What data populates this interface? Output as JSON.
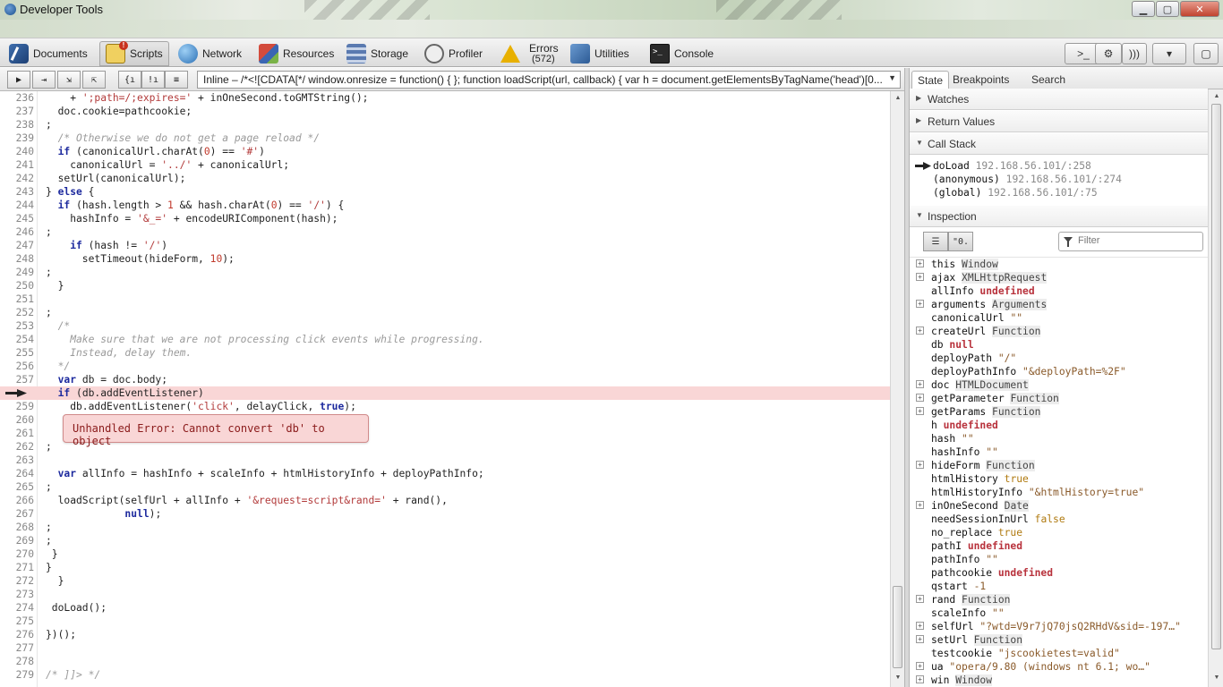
{
  "window": {
    "title": "Developer Tools",
    "controls": [
      "minimize",
      "maximize",
      "close"
    ]
  },
  "colors": {
    "error_highlight": "#f9d6d6",
    "keyword": "#1d2a9e",
    "string": "#b23a3a",
    "comment": "#9a9a9a",
    "undefined": "#b8323c"
  },
  "tabs": [
    {
      "label": "Documents",
      "icon": "documents-icon",
      "active": false
    },
    {
      "label": "Scripts",
      "icon": "scripts-icon",
      "active": true
    },
    {
      "label": "Network",
      "icon": "network-icon",
      "active": false
    },
    {
      "label": "Resources",
      "icon": "resources-icon",
      "active": false
    },
    {
      "label": "Storage",
      "icon": "storage-icon",
      "active": false
    },
    {
      "label": "Profiler",
      "icon": "profiler-icon",
      "active": false
    },
    {
      "label": "Errors",
      "count": "(572)",
      "icon": "errors-warning-icon",
      "active": false
    },
    {
      "label": "Utilities",
      "icon": "utilities-icon",
      "active": false
    },
    {
      "label": "Console",
      "icon": "console-icon",
      "active": false
    }
  ],
  "right_toolbar": [
    {
      "icon": "command-line-icon",
      "label": ">_"
    },
    {
      "icon": "settings-gear-icon",
      "label": "⚙"
    },
    {
      "icon": "speaker-icon",
      "label": ")))"
    },
    {
      "icon": "dock-menu-icon",
      "label": "▾"
    },
    {
      "icon": "detach-window-icon",
      "label": "▢"
    }
  ],
  "script_toolbar": {
    "buttons": [
      "▶",
      "⇥",
      "⇲",
      "⇱",
      "{ı",
      "!ı",
      "≡"
    ],
    "selected_script": "Inline – /*<![CDATA[*/ window.onresize = function() { }; function loadScript(url, callback) { var h = document.getElementsByTagName('head')[0..."
  },
  "code_lines": [
    {
      "n": "236",
      "t": "    + ';path=/;expires=' + inOneSecond.toGMTString();"
    },
    {
      "n": "237",
      "t": "  doc.cookie=pathcookie;"
    },
    {
      "n": "238",
      "t": ";"
    },
    {
      "n": "239",
      "t": "  /* Otherwise we do not get a page reload */"
    },
    {
      "n": "240",
      "t": "  if (canonicalUrl.charAt(0) == '#')"
    },
    {
      "n": "241",
      "t": "    canonicalUrl = '../' + canonicalUrl;"
    },
    {
      "n": "242",
      "t": "  setUrl(canonicalUrl);"
    },
    {
      "n": "243",
      "t": "} else {"
    },
    {
      "n": "244",
      "t": "  if (hash.length > 1 && hash.charAt(0) == '/') {"
    },
    {
      "n": "245",
      "t": "    hashInfo = '&_=' + encodeURIComponent(hash);"
    },
    {
      "n": "246",
      "t": ";"
    },
    {
      "n": "247",
      "t": "    if (hash != '/')"
    },
    {
      "n": "248",
      "t": "      setTimeout(hideForm, 10);"
    },
    {
      "n": "249",
      "t": ";"
    },
    {
      "n": "250",
      "t": "  }"
    },
    {
      "n": "251",
      "t": ""
    },
    {
      "n": "252",
      "t": ";"
    },
    {
      "n": "253",
      "t": "  /*"
    },
    {
      "n": "254",
      "t": "    Make sure that we are not processing click events while progressing."
    },
    {
      "n": "255",
      "t": "    Instead, delay them."
    },
    {
      "n": "256",
      "t": "  */"
    },
    {
      "n": "257",
      "t": "  var db = doc.body;"
    },
    {
      "n": "258",
      "t": "  if (db.addEventListener)"
    },
    {
      "n": "259",
      "t": "    db.addEventListener('click', delayClick, true);"
    },
    {
      "n": "260",
      "t": ""
    },
    {
      "n": "261",
      "t": ""
    },
    {
      "n": "262",
      "t": ";"
    },
    {
      "n": "263",
      "t": ""
    },
    {
      "n": "264",
      "t": "  var allInfo = hashInfo + scaleInfo + htmlHistoryInfo + deployPathInfo;"
    },
    {
      "n": "265",
      "t": ";"
    },
    {
      "n": "266",
      "t": "  loadScript(selfUrl + allInfo + '&request=script&rand=' + rand(),"
    },
    {
      "n": "267",
      "t": "             null);"
    },
    {
      "n": "268",
      "t": ";"
    },
    {
      "n": "269",
      "t": ";"
    },
    {
      "n": "270",
      "t": " }"
    },
    {
      "n": "271",
      "t": "}"
    },
    {
      "n": "272",
      "t": "  }"
    },
    {
      "n": "273",
      "t": ""
    },
    {
      "n": "274",
      "t": " doLoad();"
    },
    {
      "n": "275",
      "t": ""
    },
    {
      "n": "276",
      "t": "})();"
    },
    {
      "n": "277",
      "t": ""
    },
    {
      "n": "278",
      "t": ""
    },
    {
      "n": "279",
      "t": "/* ]]> */"
    }
  ],
  "current_line": "258",
  "error_tooltip": "Unhandled Error: Cannot convert 'db' to object",
  "right_panel": {
    "tabs": [
      "State",
      "Breakpoints",
      "Search"
    ],
    "sections": {
      "watches": "Watches",
      "return_values": "Return Values",
      "call_stack": "Call Stack",
      "inspection": "Inspection"
    },
    "call_stack": [
      {
        "fn": "doLoad",
        "loc": "192.168.56.101/:258",
        "current": true
      },
      {
        "fn": "(anonymous)",
        "loc": "192.168.56.101/:274",
        "current": false
      },
      {
        "fn": "(global)",
        "loc": "192.168.56.101/:75",
        "current": false
      }
    ],
    "filter_placeholder": "Filter",
    "variables": [
      {
        "name": "this",
        "value": "Window",
        "kind": "type",
        "expandable": true
      },
      {
        "name": "ajax",
        "value": "XMLHttpRequest",
        "kind": "type",
        "expandable": true
      },
      {
        "name": "allInfo",
        "value": "undefined",
        "kind": "undef",
        "expandable": false
      },
      {
        "name": "arguments",
        "value": "Arguments",
        "kind": "type",
        "expandable": true
      },
      {
        "name": "canonicalUrl",
        "value": "\"\"",
        "kind": "str",
        "expandable": false
      },
      {
        "name": "createUrl",
        "value": "Function",
        "kind": "type",
        "expandable": true
      },
      {
        "name": "db",
        "value": "null",
        "kind": "undef",
        "expandable": false
      },
      {
        "name": "deployPath",
        "value": "\"/\"",
        "kind": "str",
        "expandable": false
      },
      {
        "name": "deployPathInfo",
        "value": "\"&deployPath=%2F\"",
        "kind": "str",
        "expandable": false
      },
      {
        "name": "doc",
        "value": "HTMLDocument",
        "kind": "type",
        "expandable": true
      },
      {
        "name": "getParameter",
        "value": "Function",
        "kind": "type",
        "expandable": true
      },
      {
        "name": "getParams",
        "value": "Function",
        "kind": "type",
        "expandable": true
      },
      {
        "name": "h",
        "value": "undefined",
        "kind": "undef",
        "expandable": false
      },
      {
        "name": "hash",
        "value": "\"\"",
        "kind": "str",
        "expandable": false
      },
      {
        "name": "hashInfo",
        "value": "\"\"",
        "kind": "str",
        "expandable": false
      },
      {
        "name": "hideForm",
        "value": "Function",
        "kind": "type",
        "expandable": true
      },
      {
        "name": "htmlHistory",
        "value": "true",
        "kind": "bool",
        "expandable": false
      },
      {
        "name": "htmlHistoryInfo",
        "value": "\"&htmlHistory=true\"",
        "kind": "str",
        "expandable": false
      },
      {
        "name": "inOneSecond",
        "value": "Date",
        "kind": "type",
        "expandable": true
      },
      {
        "name": "needSessionInUrl",
        "value": "false",
        "kind": "bool",
        "expandable": false
      },
      {
        "name": "no_replace",
        "value": "true",
        "kind": "bool",
        "expandable": false
      },
      {
        "name": "pathI",
        "value": "undefined",
        "kind": "undef",
        "expandable": false
      },
      {
        "name": "pathInfo",
        "value": "\"\"",
        "kind": "str",
        "expandable": false
      },
      {
        "name": "pathcookie",
        "value": "undefined",
        "kind": "undef",
        "expandable": false
      },
      {
        "name": "qstart",
        "value": "-1",
        "kind": "num",
        "expandable": false
      },
      {
        "name": "rand",
        "value": "Function",
        "kind": "type",
        "expandable": true
      },
      {
        "name": "scaleInfo",
        "value": "\"\"",
        "kind": "str",
        "expandable": false
      },
      {
        "name": "selfUrl",
        "value": "\"?wtd=V9r7jQ70jsQ2RHdV&sid=-197…\"",
        "kind": "str",
        "expandable": true
      },
      {
        "name": "setUrl",
        "value": "Function",
        "kind": "type",
        "expandable": true
      },
      {
        "name": "testcookie",
        "value": "\"jscookietest=valid\"",
        "kind": "str",
        "expandable": false
      },
      {
        "name": "ua",
        "value": "\"opera/9.80 (windows nt 6.1; wo…\"",
        "kind": "str",
        "expandable": true
      },
      {
        "name": "win",
        "value": "Window",
        "kind": "type",
        "expandable": true
      }
    ]
  }
}
